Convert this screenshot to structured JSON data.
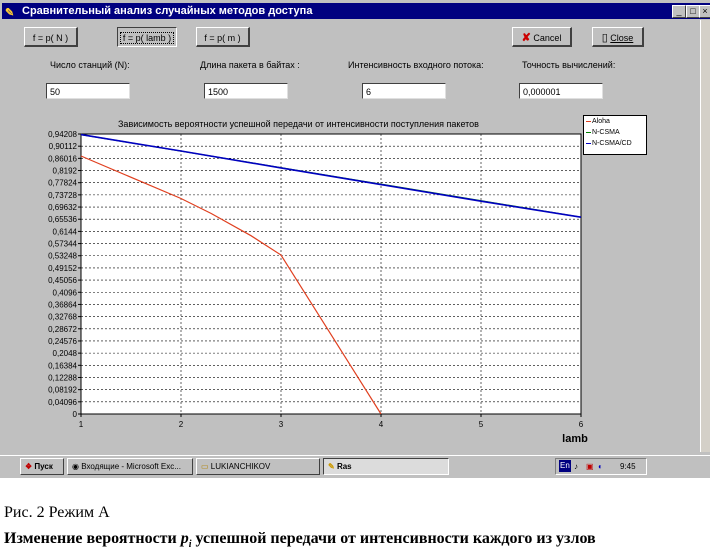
{
  "window": {
    "title": "Сравнительный анализ случайных методов доступа",
    "controls": [
      "_",
      "□",
      "×"
    ]
  },
  "toolbar": {
    "mode_buttons": [
      "f = p( N )",
      "f = p( lamb )",
      "f = p( m )"
    ],
    "cancel_label": "Cancel",
    "close_label": "Close"
  },
  "params": {
    "labels": [
      "Число станций (N):",
      "Длина пакета в байтах :",
      "Интенсивность входного потока:",
      "Точность вычислений:"
    ],
    "values": [
      "50",
      "1500",
      "6",
      "0,000001"
    ]
  },
  "chart_data": {
    "type": "line",
    "title": "Зависимость вероятности успешной передачи от интенсивности поступления пакетов",
    "xlabel": "lamb",
    "ylabel": "",
    "xlim": [
      1,
      6
    ],
    "ylim": [
      0,
      0.94208
    ],
    "x_ticks": [
      "1",
      "2",
      "3",
      "4",
      "5",
      "6"
    ],
    "y_ticks": [
      "0,94208",
      "0,90112",
      "0,86016",
      "0,8192",
      "0,77824",
      "0,73728",
      "0,69632",
      "0,65536",
      "0,6144",
      "0,57344",
      "0,53248",
      "0,49152",
      "0,45056",
      "0,4096",
      "0,36864",
      "0,32768",
      "0,28672",
      "0,24576",
      "0,2048",
      "0,16384",
      "0,12288",
      "0,08192",
      "0,04096",
      "0"
    ],
    "grid": true,
    "legend_position": "top-right",
    "series": [
      {
        "name": "Aloha",
        "color": "#e04020",
        "x": [
          1,
          2,
          2.3,
          2.7,
          3,
          4
        ],
        "y": [
          0.868,
          0.725,
          0.675,
          0.6,
          0.535,
          0
        ]
      },
      {
        "name": "N-CSMA",
        "color": "#008000",
        "x": [
          1,
          6
        ],
        "y": [
          0.94,
          0.662
        ]
      },
      {
        "name": "N-CSMA/CD",
        "color": "#0000c0",
        "x": [
          1,
          2,
          3,
          4,
          5,
          6
        ],
        "y": [
          0.94,
          0.885,
          0.828,
          0.772,
          0.716,
          0.662
        ]
      }
    ]
  },
  "taskbar": {
    "start_label": "Пуск",
    "items": [
      "Входящие - Microsoft Exc...",
      "LUKIANCHIKOV",
      "Ras"
    ],
    "tray_lang": "En",
    "clock": "9:45"
  },
  "document": {
    "caption": "Рис. 2 Режим А",
    "text_before": "Изменение вероятности ",
    "symbol": "p",
    "subscript": "i",
    "text_after": " успешной передачи от интенсивности каждого из узлов"
  },
  "colors": {
    "titlebar": "#000080",
    "window_face": "#c0c0c0",
    "plot_background": "#ffffff"
  }
}
